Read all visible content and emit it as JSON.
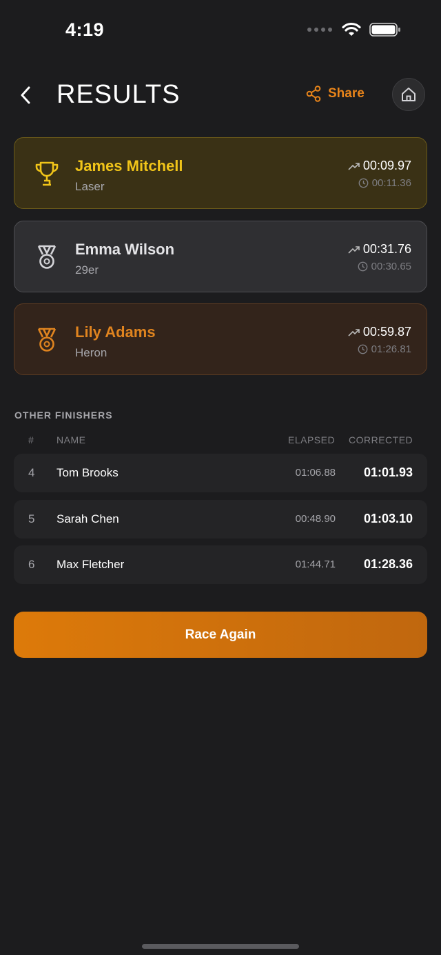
{
  "status": {
    "time": "4:19"
  },
  "header": {
    "title": "RESULTS",
    "share_label": "Share"
  },
  "colors": {
    "accent": "#e8841a",
    "gold": "#f0c419",
    "silver": "#d4d4d8",
    "bronze": "#e0841f",
    "background": "#1c1c1e"
  },
  "podium": [
    {
      "rank": 1,
      "medal": "trophy-icon",
      "name": "James Mitchell",
      "boat_class": "Laser",
      "elapsed": "00:09.97",
      "corrected": "00:11.36"
    },
    {
      "rank": 2,
      "medal": "medal-silver-icon",
      "name": "Emma Wilson",
      "boat_class": "29er",
      "elapsed": "00:31.76",
      "corrected": "00:30.65"
    },
    {
      "rank": 3,
      "medal": "medal-bronze-icon",
      "name": "Lily Adams",
      "boat_class": "Heron",
      "elapsed": "00:59.87",
      "corrected": "01:26.81"
    }
  ],
  "other_finishers": {
    "section_label": "OTHER FINISHERS",
    "columns": {
      "rank": "#",
      "name": "NAME",
      "elapsed": "ELAPSED",
      "corrected": "CORRECTED"
    },
    "rows": [
      {
        "rank": "4",
        "name": "Tom Brooks",
        "elapsed": "01:06.88",
        "corrected": "01:01.93"
      },
      {
        "rank": "5",
        "name": "Sarah Chen",
        "elapsed": "00:48.90",
        "corrected": "01:03.10"
      },
      {
        "rank": "6",
        "name": "Max Fletcher",
        "elapsed": "01:44.71",
        "corrected": "01:28.36"
      }
    ]
  },
  "cta": {
    "label": "Race Again"
  }
}
